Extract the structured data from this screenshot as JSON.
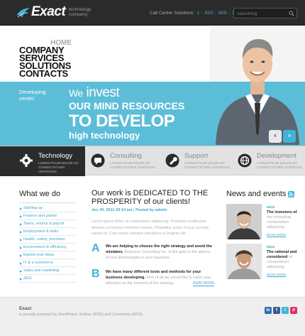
{
  "header": {
    "logo": "Exact",
    "tagline": "technology company",
    "call_label": "Call Center Solutions:",
    "call_number": "1 - 800 - 458 - 7956",
    "search_placeholder": "searching"
  },
  "menu": {
    "home": "HOME",
    "items": [
      "COMPANY",
      "SERVICES",
      "SOLUTIONS",
      "CONTACTS"
    ]
  },
  "slider": {
    "developing": "Developing center:",
    "we": "We",
    "invest": "invest",
    "line2": "OUR MIND RESOURCES",
    "line3": "TO DEVELOP",
    "line4": "high technology",
    "prev_icon": "‹",
    "next_icon": "›"
  },
  "services": [
    {
      "title": "Technology",
      "desc": "LOREM IPSUM DOLOR SIT CONSECTETUER ADIPISCING",
      "icon": "gear-icon"
    },
    {
      "title": "Consulting",
      "desc": "LOREM IPSUM DOLOR SIT CONSECTETUER ADIPISCING",
      "icon": "chat-icon"
    },
    {
      "title": "Support",
      "desc": "LOREM IPSUM DOLOR SIT CONSECTETUER ADIPISCING",
      "icon": "wrench-icon"
    },
    {
      "title": "Development",
      "desc": "LOREM IPSUM DOLOR SIT CONSECTETUER ADIPISCING",
      "icon": "globe-icon"
    }
  ],
  "what_we_do": {
    "title": "What we do",
    "items": [
      "Starting up",
      "Finance and grants",
      "Taxes, returns & payroll",
      "Employment & skills",
      "Health, safety, premises",
      "Environment & efficiency",
      "Exploit your ideas",
      "IT & e-commerce",
      "Sales and marketing",
      "SEO"
    ]
  },
  "main": {
    "title": "Our work is DEDICATED TO THE PROSPERITY of our clients!",
    "date": "Jun 30, 2011 09:10 am",
    "author": "Posted by admin",
    "para": "Lorem ipsum dolor sit consectetur adipiscing. Praesent vestibulum. Aenean nonummy hendrerit mauris. Phasellus porta. Fusce suscipit varius mi. Cum sociis natoque penatibus et magnis dis.",
    "a_letter": "A",
    "a_bold": "We are helping to choose the right strategy and avoid the mistakes.",
    "a_text": "Business Consulting Inc. is the gate to the sphere of new technologies in your business.",
    "b_letter": "B",
    "b_bold": "We have many different tools and methods for your business developing.",
    "b_text": "First of all we would like to catch your attention on the moment of the strategy.",
    "read_more": "READ MORE"
  },
  "news": {
    "title": "News and events",
    "items": [
      {
        "date": "06/20",
        "bold": "The investors of",
        "text": "the consulting consectetuer adipiscing.",
        "more": "READ MORE"
      },
      {
        "date": "06/20",
        "bold": "The rational and considered",
        "text": "sit consectetuer adipiscing.",
        "more": "READ MORE"
      }
    ]
  },
  "footer": {
    "name": "Exact",
    "powered": "is proudly powered by WordPress. Entries (RSS) and Comments (RSS)",
    "social": [
      "in",
      "f",
      "t",
      "d"
    ]
  },
  "colors": {
    "accent": "#3fb3d8",
    "band": "#5cbdd8",
    "dark": "#2b2b2b"
  }
}
